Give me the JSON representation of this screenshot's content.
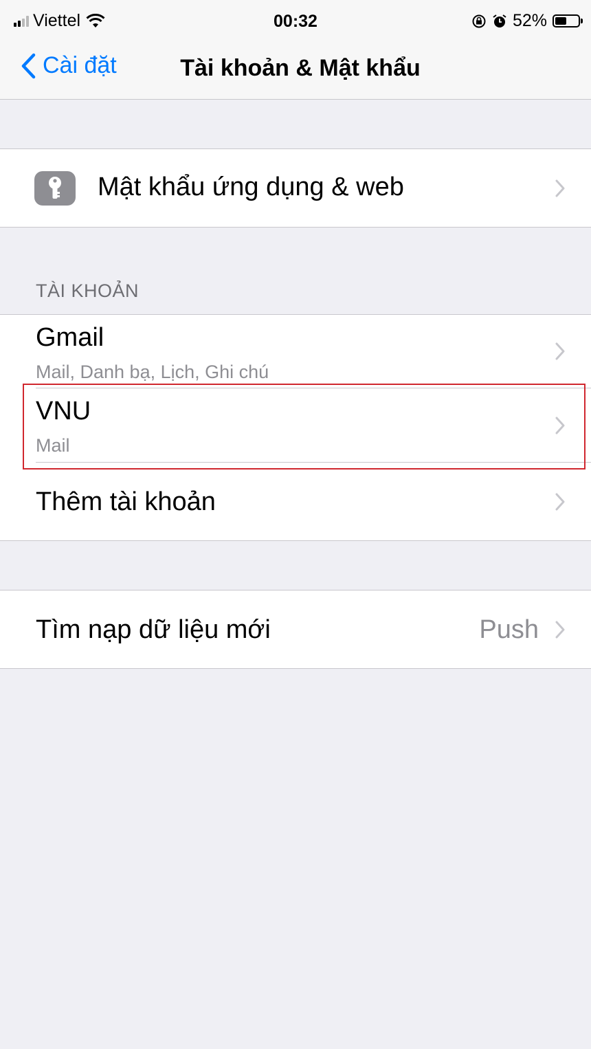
{
  "status_bar": {
    "carrier": "Viettel",
    "time": "00:32",
    "battery_percent": "52%",
    "battery_level": 0.52,
    "icons": [
      "signal-icon",
      "wifi-icon",
      "rotation-lock-icon",
      "alarm-icon",
      "battery-icon"
    ]
  },
  "nav": {
    "back_label": "Cài đặt",
    "title": "Tài khoản & Mật khẩu"
  },
  "passwords_row": {
    "label": "Mật khẩu ứng dụng & web",
    "icon": "key-icon"
  },
  "accounts": {
    "header": "TÀI KHOẢN",
    "items": [
      {
        "title": "Gmail",
        "subtitle": "Mail, Danh bạ, Lịch, Ghi chú"
      },
      {
        "title": "VNU",
        "subtitle": "Mail"
      }
    ],
    "add_label": "Thêm tài khoản"
  },
  "fetch_row": {
    "label": "Tìm nạp dữ liệu mới",
    "value": "Push"
  },
  "colors": {
    "accent": "#007aff",
    "highlight_border": "#d0272e",
    "background": "#efeff4"
  }
}
